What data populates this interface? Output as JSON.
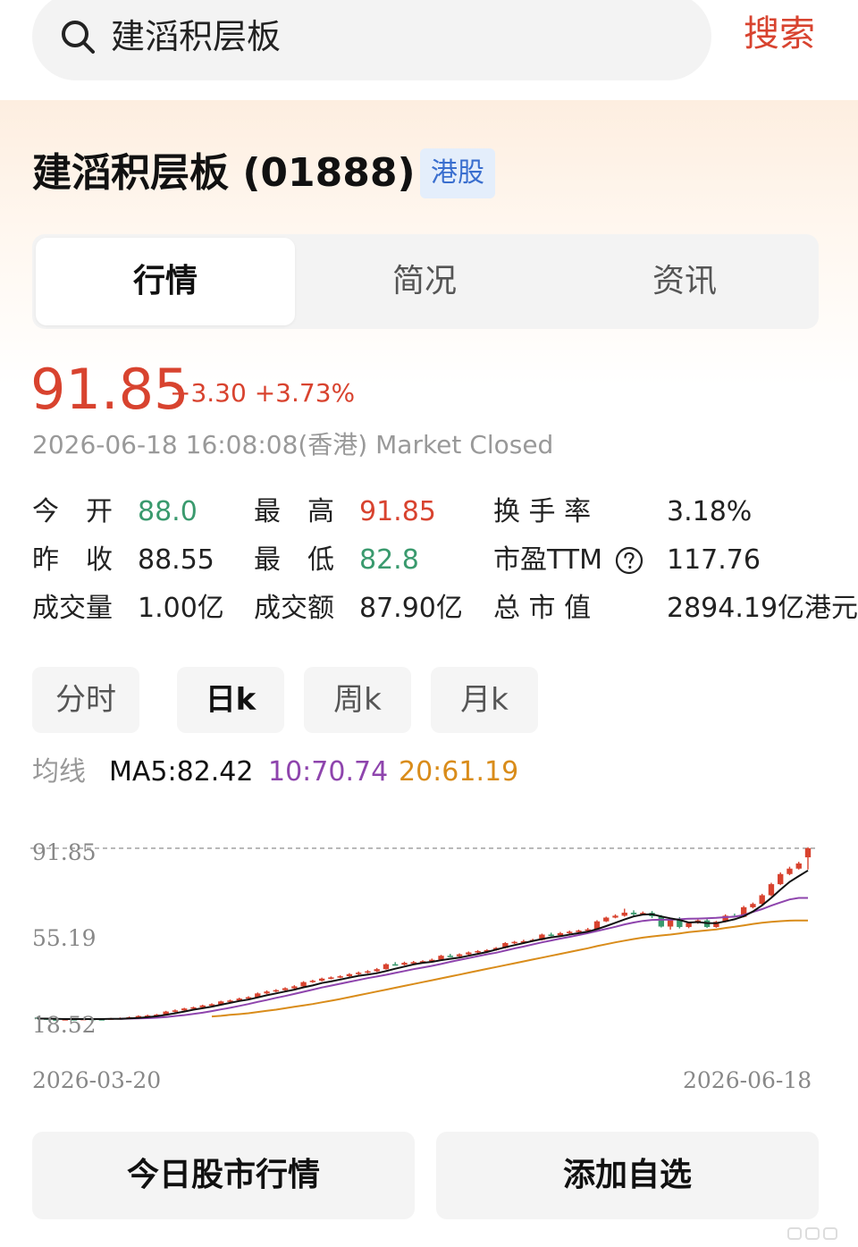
{
  "search": {
    "query": "建滔积层板",
    "button": "搜索"
  },
  "stock": {
    "title": "建滔积层板 (01888)",
    "market": "港股"
  },
  "tabs": [
    "行情",
    "简况",
    "资讯"
  ],
  "quote": {
    "price": "91.85",
    "change": "+3.30 +3.73%",
    "timestamp": "2026-06-18 16:08:08(香港) Market Closed"
  },
  "stats": {
    "open_label": "今　开",
    "open_value": "88.0",
    "high_label": "最　高",
    "high_value": "91.85",
    "turnover_rate_label": "换 手 率",
    "turnover_rate_value": "3.18%",
    "prev_close_label": "昨　收",
    "prev_close_value": "88.55",
    "low_label": "最　低",
    "low_value": "82.8",
    "pe_label": "市盈TTM",
    "pe_value": "117.76",
    "volume_label": "成交量",
    "volume_value": "1.00亿",
    "amount_label": "成交额",
    "amount_value": "87.90亿",
    "mkt_cap_label": "总 市 值",
    "mkt_cap_value": "2894.19亿港元"
  },
  "period_tabs": [
    "分时",
    "日k",
    "周k",
    "月k"
  ],
  "ma": {
    "label": "均线",
    "ma5": "MA5:82.42",
    "ma10": "10:70.74",
    "ma20": "20:61.19"
  },
  "colors": {
    "up": "#d8432f",
    "down": "#3a9a6e",
    "ma5": "#111111",
    "ma10": "#8e44ad",
    "ma20": "#d98c1a"
  },
  "chart_data": {
    "type": "candlestick",
    "y_ticks": [
      "91.85",
      "55.19",
      "18.52"
    ],
    "x_ticks": [
      "2026-03-20",
      "2026-06-18"
    ],
    "ylim": [
      14,
      96
    ],
    "reference_line": 91.85,
    "candles": [
      [
        20.0,
        19.6,
        20.3,
        19.4
      ],
      [
        19.6,
        19.2,
        19.8,
        19.0
      ],
      [
        19.2,
        19.0,
        19.4,
        18.8
      ],
      [
        19.0,
        19.3,
        19.5,
        18.9
      ],
      [
        19.3,
        19.2,
        19.5,
        19.0
      ],
      [
        19.2,
        19.4,
        19.6,
        19.0
      ],
      [
        19.4,
        19.3,
        19.6,
        19.1
      ],
      [
        19.3,
        19.2,
        19.5,
        19.0
      ],
      [
        19.2,
        19.6,
        19.8,
        19.0
      ],
      [
        19.6,
        19.7,
        20.0,
        19.4
      ],
      [
        19.7,
        20.1,
        20.4,
        19.6
      ],
      [
        20.1,
        20.6,
        20.9,
        19.9
      ],
      [
        20.6,
        20.8,
        21.2,
        20.4
      ],
      [
        20.8,
        21.2,
        21.5,
        20.6
      ],
      [
        21.2,
        22.5,
        22.8,
        21.0
      ],
      [
        22.5,
        23.0,
        23.4,
        22.2
      ],
      [
        23.0,
        23.8,
        24.1,
        22.8
      ],
      [
        23.8,
        24.3,
        24.6,
        23.5
      ],
      [
        24.3,
        25.1,
        25.4,
        24.0
      ],
      [
        25.1,
        25.6,
        26.0,
        24.9
      ],
      [
        25.6,
        26.8,
        27.1,
        25.4
      ],
      [
        26.8,
        27.2,
        27.6,
        26.5
      ],
      [
        27.2,
        28.0,
        28.4,
        27.0
      ],
      [
        28.0,
        28.6,
        29.0,
        27.7
      ],
      [
        28.6,
        30.2,
        30.6,
        28.4
      ],
      [
        30.2,
        31.0,
        31.5,
        29.9
      ],
      [
        31.0,
        31.6,
        32.0,
        30.7
      ],
      [
        31.6,
        32.4,
        32.8,
        31.3
      ],
      [
        32.4,
        33.2,
        33.7,
        32.1
      ],
      [
        33.2,
        35.0,
        35.4,
        33.0
      ],
      [
        35.0,
        35.6,
        36.0,
        34.7
      ],
      [
        35.6,
        36.5,
        36.9,
        35.3
      ],
      [
        36.5,
        37.0,
        37.4,
        36.2
      ],
      [
        37.0,
        37.5,
        37.9,
        36.7
      ],
      [
        37.5,
        38.4,
        38.8,
        37.2
      ],
      [
        38.4,
        39.0,
        39.5,
        38.1
      ],
      [
        39.0,
        39.6,
        40.1,
        38.7
      ],
      [
        39.6,
        40.5,
        41.0,
        39.3
      ],
      [
        40.5,
        42.6,
        43.0,
        40.3
      ],
      [
        42.6,
        42.4,
        43.5,
        42.0
      ],
      [
        42.4,
        43.2,
        43.7,
        42.1
      ],
      [
        43.2,
        43.5,
        44.0,
        42.9
      ],
      [
        43.5,
        43.9,
        44.3,
        43.2
      ],
      [
        43.9,
        44.5,
        45.0,
        43.6
      ],
      [
        44.5,
        46.2,
        46.6,
        44.3
      ],
      [
        46.2,
        46.0,
        47.0,
        45.7
      ],
      [
        46.0,
        46.8,
        47.2,
        45.6
      ],
      [
        46.8,
        47.6,
        48.0,
        46.5
      ],
      [
        47.6,
        48.2,
        48.6,
        47.3
      ],
      [
        48.2,
        48.6,
        49.0,
        47.9
      ],
      [
        48.6,
        49.5,
        49.9,
        48.3
      ],
      [
        49.5,
        51.6,
        52.0,
        49.3
      ],
      [
        51.6,
        52.1,
        52.5,
        51.2
      ],
      [
        52.1,
        52.4,
        53.0,
        51.8
      ],
      [
        52.4,
        52.9,
        53.4,
        52.1
      ],
      [
        52.9,
        55.2,
        55.6,
        52.7
      ],
      [
        55.2,
        54.9,
        56.0,
        54.5
      ],
      [
        54.9,
        55.8,
        56.3,
        54.6
      ],
      [
        55.8,
        56.4,
        56.9,
        55.5
      ],
      [
        56.4,
        56.9,
        57.3,
        56.1
      ],
      [
        56.9,
        57.4,
        58.0,
        56.6
      ],
      [
        57.4,
        60.8,
        61.3,
        57.2
      ],
      [
        60.8,
        62.4,
        62.8,
        60.5
      ],
      [
        62.4,
        63.2,
        63.8,
        62.1
      ],
      [
        63.2,
        64.5,
        66.2,
        62.8
      ],
      [
        64.5,
        63.8,
        65.5,
        62.9
      ],
      [
        63.8,
        64.4,
        65.0,
        63.4
      ],
      [
        64.4,
        63.0,
        65.2,
        62.2
      ],
      [
        63.0,
        58.6,
        63.5,
        58.2
      ],
      [
        58.6,
        61.4,
        61.8,
        57.3
      ],
      [
        61.4,
        58.4,
        62.6,
        57.8
      ],
      [
        58.4,
        60.1,
        60.5,
        57.9
      ],
      [
        60.1,
        61.2,
        61.6,
        59.8
      ],
      [
        61.2,
        58.4,
        61.8,
        58.0
      ],
      [
        58.4,
        60.6,
        61.0,
        58.1
      ],
      [
        60.6,
        63.2,
        63.8,
        60.4
      ],
      [
        63.2,
        62.7,
        64.1,
        62.4
      ],
      [
        62.7,
        66.8,
        67.4,
        62.5
      ],
      [
        66.8,
        68.2,
        68.8,
        66.3
      ],
      [
        68.2,
        71.9,
        72.5,
        67.8
      ],
      [
        71.9,
        76.6,
        77.2,
        71.5
      ],
      [
        76.6,
        80.9,
        81.6,
        76.2
      ],
      [
        80.9,
        83.2,
        84.0,
        80.4
      ],
      [
        83.2,
        85.4,
        86.1,
        82.8
      ],
      [
        88.0,
        91.85,
        92.3,
        82.8
      ]
    ],
    "ma5": [
      19.5,
      19.5,
      19.4,
      19.3,
      19.3,
      19.3,
      19.3,
      19.3,
      19.4,
      19.4,
      19.6,
      19.8,
      20.1,
      20.5,
      21.1,
      21.8,
      22.5,
      23.3,
      23.9,
      24.6,
      25.4,
      26.2,
      27.0,
      27.6,
      28.5,
      29.4,
      30.2,
      31.0,
      31.8,
      32.8,
      33.6,
      34.6,
      35.3,
      36.1,
      36.9,
      37.7,
      38.2,
      38.8,
      39.7,
      40.7,
      41.6,
      42.5,
      43.2,
      43.6,
      44.3,
      44.9,
      45.4,
      46.2,
      47.0,
      47.8,
      48.8,
      49.8,
      50.7,
      51.6,
      52.5,
      53.3,
      54.0,
      54.5,
      55.2,
      55.8,
      56.4,
      57.5,
      58.8,
      60.2,
      61.6,
      62.9,
      63.7,
      63.8,
      62.9,
      62.1,
      61.4,
      60.3,
      60.5,
      60.1,
      60.0,
      60.8,
      61.7,
      63.0,
      65.0,
      67.6,
      70.8,
      74.3,
      77.6,
      80.0,
      82.42
    ],
    "ma10": [
      null,
      null,
      null,
      null,
      null,
      null,
      null,
      null,
      null,
      19.4,
      19.5,
      19.6,
      19.7,
      19.9,
      20.2,
      20.6,
      21.0,
      21.5,
      22.0,
      22.7,
      23.4,
      24.1,
      24.9,
      25.7,
      26.6,
      27.4,
      28.3,
      29.1,
      30.0,
      30.9,
      31.8,
      32.7,
      33.5,
      34.3,
      35.1,
      35.9,
      36.7,
      37.4,
      38.1,
      38.9,
      39.7,
      40.5,
      41.2,
      41.9,
      42.7,
      43.6,
      44.4,
      45.2,
      46.0,
      46.8,
      47.5,
      48.4,
      49.3,
      50.1,
      51.0,
      51.9,
      52.7,
      53.5,
      54.2,
      55.0,
      55.8,
      56.7,
      57.6,
      58.5,
      59.5,
      60.3,
      61.0,
      61.4,
      61.5,
      61.5,
      61.7,
      61.9,
      62.0,
      62.1,
      62.3,
      62.6,
      62.8,
      63.5,
      64.8,
      66.0,
      67.5,
      68.8,
      70.1,
      70.74,
      70.74
    ],
    "ma20": [
      null,
      null,
      null,
      null,
      null,
      null,
      null,
      null,
      null,
      null,
      null,
      null,
      null,
      null,
      null,
      null,
      null,
      null,
      null,
      20.4,
      20.7,
      21.1,
      21.4,
      21.8,
      22.3,
      22.8,
      23.3,
      23.9,
      24.5,
      25.1,
      25.7,
      26.4,
      27.1,
      27.8,
      28.6,
      29.4,
      30.2,
      31.0,
      31.8,
      32.6,
      33.4,
      34.2,
      35.0,
      35.8,
      36.6,
      37.4,
      38.2,
      39.0,
      39.8,
      40.6,
      41.4,
      42.2,
      43.0,
      43.8,
      44.6,
      45.4,
      46.2,
      47.0,
      47.8,
      48.6,
      49.4,
      50.3,
      51.1,
      51.9,
      52.6,
      53.3,
      53.9,
      54.4,
      54.8,
      55.2,
      55.7,
      56.2,
      56.6,
      57.0,
      57.4,
      58.0,
      58.5,
      59.1,
      59.7,
      60.2,
      60.6,
      60.9,
      61.1,
      61.19,
      61.19
    ]
  },
  "bottom": {
    "btn_left": "今日股市行情",
    "btn_right": "添加自选"
  }
}
